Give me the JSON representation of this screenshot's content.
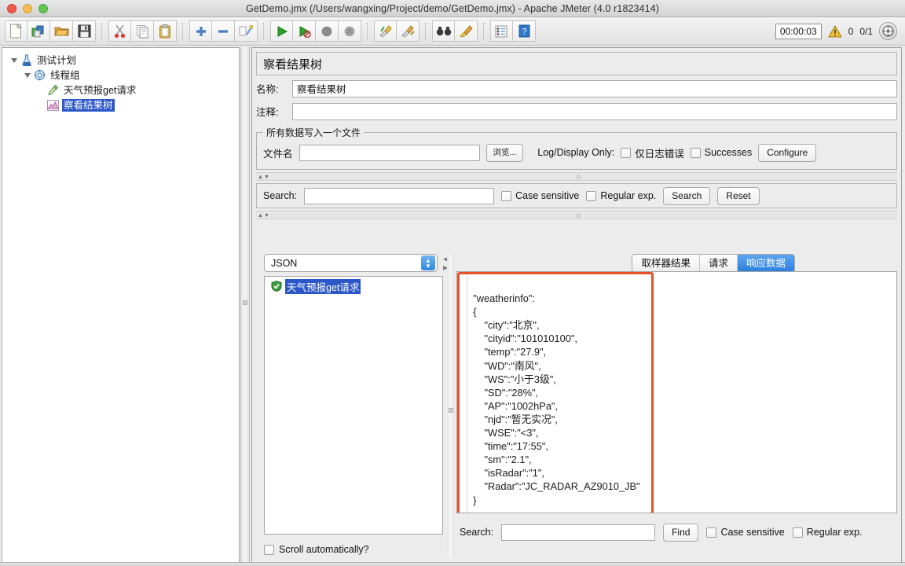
{
  "window": {
    "title": "GetDemo.jmx (/Users/wangxing/Project/demo/GetDemo.jmx) - Apache JMeter (4.0 r1823414)"
  },
  "toolbar": {
    "icons": [
      "new-file-icon",
      "new-template-icon",
      "open-icon",
      "save-icon",
      "cut-icon",
      "copy-icon",
      "paste-icon",
      "expand-all-icon",
      "collapse-all-icon",
      "toggle-icon",
      "start-icon",
      "start-no-pauses-icon",
      "stop-icon",
      "shutdown-icon",
      "clear-icon",
      "clear-all-icon",
      "search-icon",
      "search-reset-icon",
      "function-helper-icon",
      "help-icon"
    ],
    "timer": "00:00:03",
    "warning_count": "0",
    "thread_count": "0/1",
    "gear_label": "gear-icon"
  },
  "tree": {
    "nodes": [
      {
        "label": "测试计划",
        "icon": "test-plan-icon",
        "depth": 0,
        "selected": false,
        "expanded": true
      },
      {
        "label": "线程组",
        "icon": "thread-group-icon",
        "depth": 1,
        "selected": false,
        "expanded": true
      },
      {
        "label": "天气预报get请求",
        "icon": "http-request-icon",
        "depth": 2,
        "selected": false,
        "expanded": false
      },
      {
        "label": "察看结果树",
        "icon": "view-results-tree-icon",
        "depth": 2,
        "selected": true,
        "expanded": false
      }
    ]
  },
  "panel": {
    "title": "察看结果树",
    "name_label": "名称:",
    "name_value": "察看结果树",
    "comment_label": "注释:",
    "comment_value": "",
    "file_group_legend": "所有数据写入一个文件",
    "filename_label": "文件名",
    "filename_value": "",
    "browse_button": "浏览...",
    "log_display_label": "Log/Display Only:",
    "errors_only_label": "仅日志错误",
    "successes_label": "Successes",
    "configure_button": "Configure"
  },
  "search_bar": {
    "label": "Search:",
    "value": "",
    "case_sensitive_label": "Case sensitive",
    "regular_exp_label": "Regular exp.",
    "search_button": "Search",
    "reset_button": "Reset"
  },
  "results": {
    "renderer_selected": "JSON",
    "sampler_node_label": "天气预报get请求",
    "sampler_node_icon": "success-shield-icon",
    "scroll_auto_label": "Scroll automatically?",
    "tabs": [
      {
        "label": "取样器结果",
        "active": false
      },
      {
        "label": "请求",
        "active": false
      },
      {
        "label": "响应数据",
        "active": true
      }
    ],
    "response_text": "{\n    \"weatherinfo\":\n    {\n        \"city\":\"北京\",\n        \"cityid\":\"101010100\",\n        \"temp\":\"27.9\",\n        \"WD\":\"南风\",\n        \"WS\":\"小于3级\",\n        \"SD\":\"28%\",\n        \"AP\":\"1002hPa\",\n        \"njd\":\"暂无实况\",\n        \"WSE\":\"<3\",\n        \"time\":\"17:55\",\n        \"sm\":\"2.1\",\n        \"isRadar\":\"1\",\n        \"Radar\":\"JC_RADAR_AZ9010_JB\"\n    }\n}",
    "annotation_color": "#e8502a"
  },
  "bottom_search": {
    "label": "Search:",
    "value": "",
    "find_button": "Find",
    "case_sensitive_label": "Case sensitive",
    "regular_exp_label": "Regular exp."
  }
}
